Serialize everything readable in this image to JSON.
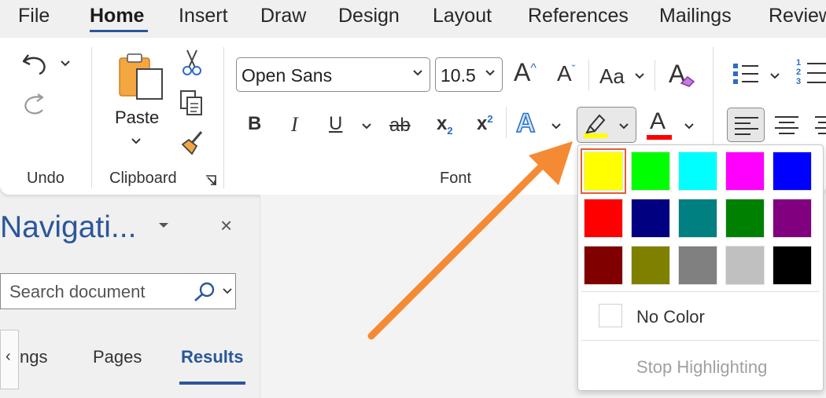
{
  "tabs": [
    "File",
    "Home",
    "Insert",
    "Draw",
    "Design",
    "Layout",
    "References",
    "Mailings",
    "Review"
  ],
  "active_tab": "Home",
  "ribbon": {
    "groups": {
      "undo": "Undo",
      "clipboard": "Clipboard",
      "font": "Font"
    },
    "paste_label": "Paste",
    "font_name": "Open Sans",
    "font_size": "10.5",
    "change_case": "Aa",
    "bold": "B",
    "italic": "I",
    "underline": "U",
    "strikethrough": "ab",
    "subscript": "x",
    "subscript_mark": "2",
    "superscript": "x",
    "superscript_mark": "2",
    "text_effects": "A",
    "font_color_letter": "A",
    "grow_font": "A",
    "shrink_font": "A",
    "clear_format": "A",
    "list_numbers": [
      "1",
      "2",
      "3"
    ]
  },
  "nav_pane": {
    "title": "Navigati...",
    "search_placeholder": "Search document",
    "tabs": [
      "ngs",
      "Pages",
      "Results"
    ],
    "active_tab": "Results",
    "scroll_left": "‹",
    "close": "×"
  },
  "highlight_menu": {
    "colors": [
      [
        "#ffff00",
        "#00ff00",
        "#00ffff",
        "#ff00ff",
        "#0000ff"
      ],
      [
        "#ff0000",
        "#000080",
        "#008080",
        "#008000",
        "#800080"
      ],
      [
        "#800000",
        "#808000",
        "#808080",
        "#c0c0c0",
        "#000000"
      ]
    ],
    "selected_color": "#ffff00",
    "no_color": "No Color",
    "stop_highlighting": "Stop Highlighting"
  },
  "colors": {
    "accent": "#2b579a",
    "arrow": "#f58a34",
    "highlight": "#ffff00",
    "font_color": "#ff0000",
    "selected_swatch_border": "#e06030"
  }
}
